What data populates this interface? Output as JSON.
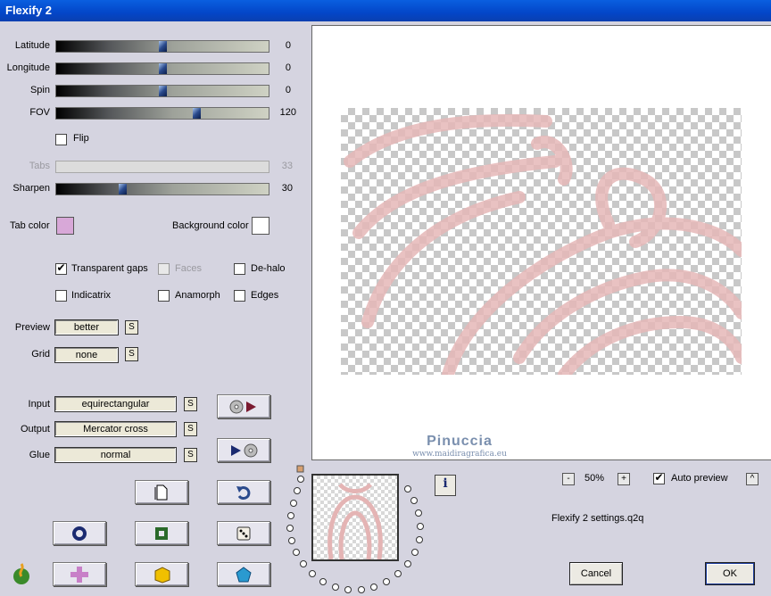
{
  "window": {
    "title": "Flexify 2"
  },
  "sliders": [
    {
      "label": "Latitude",
      "value": "0",
      "level": 0.5,
      "enabled": true
    },
    {
      "label": "Longitude",
      "value": "0",
      "level": 0.5,
      "enabled": true
    },
    {
      "label": "Spin",
      "value": "0",
      "level": 0.5,
      "enabled": true
    },
    {
      "label": "FOV",
      "value": "120",
      "level": 0.66,
      "enabled": true
    },
    {
      "label": "Tabs",
      "value": "33",
      "level": 0.33,
      "enabled": false
    },
    {
      "label": "Sharpen",
      "value": "30",
      "level": 0.3,
      "enabled": true
    }
  ],
  "flip": {
    "label": "Flip",
    "checked": false
  },
  "colors": {
    "tab_label": "Tab color",
    "tab_color": "#d8a8d8",
    "bg_label": "Background color",
    "bg_color": "#ffffff"
  },
  "options": {
    "transparent_gaps": {
      "label": "Transparent gaps",
      "checked": true
    },
    "faces": {
      "label": "Faces",
      "checked": false,
      "enabled": false
    },
    "de_halo": {
      "label": "De-halo",
      "checked": false
    },
    "indicatrix": {
      "label": "Indicatrix",
      "checked": false
    },
    "anamorph": {
      "label": "Anamorph",
      "checked": false
    },
    "edges": {
      "label": "Edges",
      "checked": false
    }
  },
  "selects": {
    "preview": {
      "label": "Preview",
      "value": "better"
    },
    "grid": {
      "label": "Grid",
      "value": "none"
    },
    "input": {
      "label": "Input",
      "value": "equirectangular"
    },
    "output": {
      "label": "Output",
      "value": "Mercator cross"
    },
    "glue": {
      "label": "Glue",
      "value": "normal"
    }
  },
  "s_button": "S",
  "watermark": {
    "name": "Pinuccia",
    "site": "www.maidiragrafica.eu"
  },
  "zoom": {
    "minus": "-",
    "value": "50%",
    "plus": "+"
  },
  "auto_preview": {
    "label": "Auto preview",
    "checked": true,
    "arrow": "^"
  },
  "settings_file": "Flexify 2 settings.q2q",
  "info_label": "i",
  "cancel": "Cancel",
  "ok": "OK",
  "icons": [
    "swap-input-icon",
    "swap-output-icon",
    "new-document-icon",
    "undo-icon",
    "ring-icon",
    "square-icon",
    "dice-icon",
    "flame-icon",
    "cross-icon",
    "box-icon",
    "pentagon-icon"
  ],
  "accent": "#0a5fe0"
}
